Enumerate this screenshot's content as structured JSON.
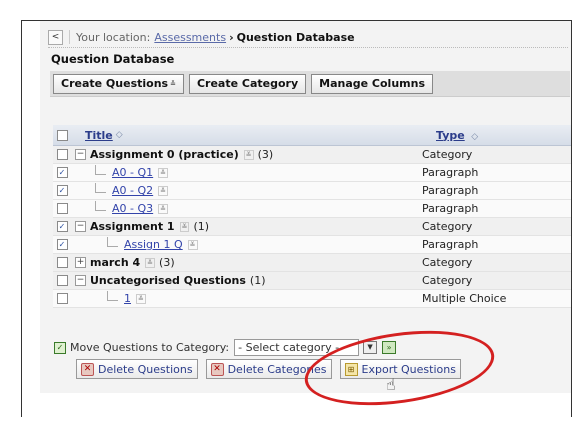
{
  "breadcrumb": {
    "back_glyph": "<",
    "lead": "Your location:",
    "link": "Assessments",
    "arrow": "›",
    "current": "Question Database"
  },
  "page_title": "Question Database",
  "toolbar": {
    "create_questions": "Create Questions",
    "create_category": "Create Category",
    "manage_columns": "Manage Columns"
  },
  "grid": {
    "header": {
      "title": "Title",
      "type": "Type"
    },
    "rows": [
      {
        "title": "Assignment 0 (practice)",
        "count": "(3)",
        "type": "Category",
        "checked": false
      },
      {
        "title": "A0 - Q1",
        "type": "Paragraph",
        "checked": true
      },
      {
        "title": "A0 - Q2",
        "type": "Paragraph",
        "checked": true
      },
      {
        "title": "A0 - Q3",
        "type": "Paragraph",
        "checked": false
      },
      {
        "title": "Assignment 1",
        "count": "(1)",
        "type": "Category",
        "checked": true
      },
      {
        "title": "Assign 1 Q",
        "type": "Paragraph",
        "checked": true
      },
      {
        "title": "march 4",
        "count": "(3)",
        "type": "Category",
        "checked": false
      },
      {
        "title": "Uncategorised Questions",
        "count": "(1)",
        "type": "Category",
        "checked": false
      },
      {
        "title": "1",
        "type": "Multiple Choice",
        "checked": false
      }
    ]
  },
  "actions": {
    "move_label": "Move Questions to Category:",
    "select_placeholder": "- Select category -",
    "delete_questions": "Delete Questions",
    "delete_categories": "Delete Categories",
    "export_questions": "Export Questions"
  },
  "icons": {
    "check": "✓",
    "minus": "−",
    "plus": "+",
    "sort": "◇",
    "menu": "≚",
    "x": "✕",
    "go": "»",
    "export": "⊞",
    "dropdown": "▼",
    "cursor": "☝"
  },
  "colors": {
    "annotation_ring": "#d42020",
    "link": "#3344aa"
  }
}
